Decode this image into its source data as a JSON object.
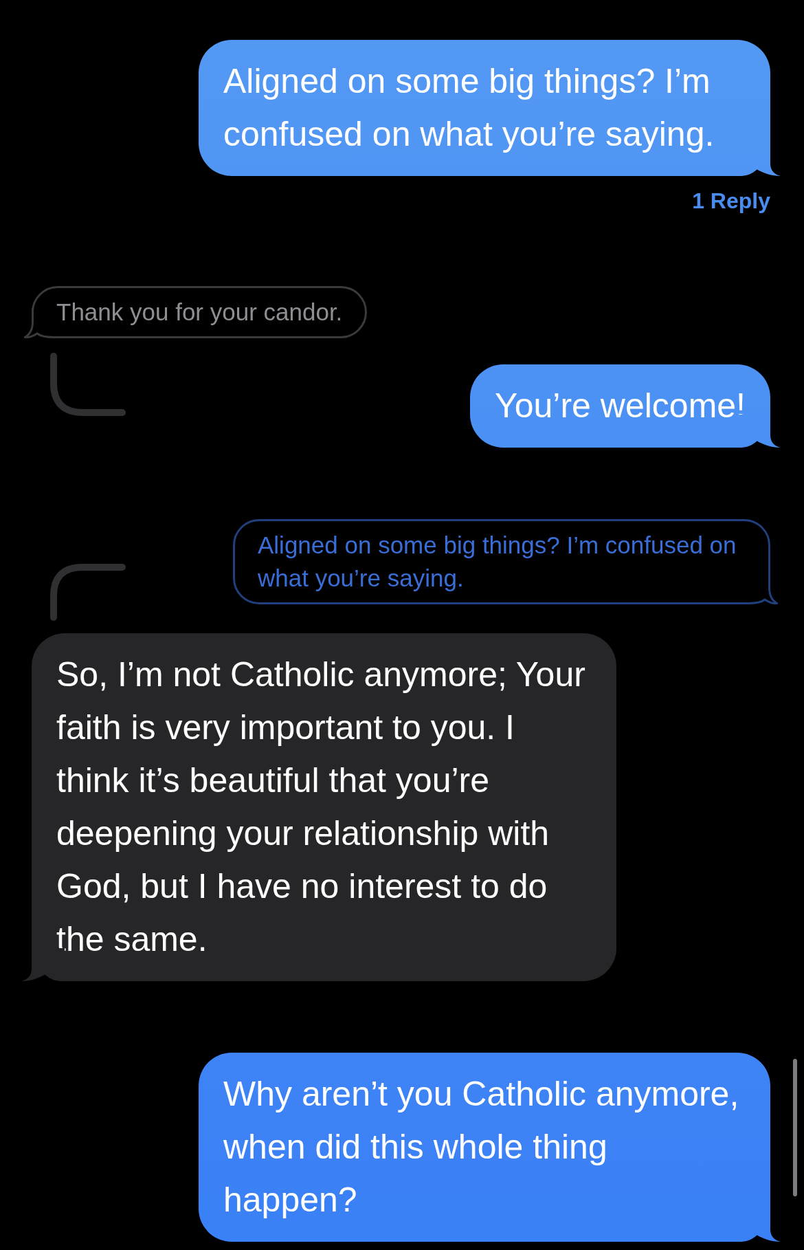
{
  "messages": [
    {
      "kind": "sent",
      "text": "Aligned on some big things? I’m confused on what you’re saying.",
      "replies": "1 Reply"
    },
    {
      "kind": "quote_received",
      "text": "Thank you for your candor."
    },
    {
      "kind": "sent",
      "text": "You’re welcome!",
      "thread_from_above": true
    },
    {
      "kind": "quote_sent",
      "text": "Aligned on some big things? I’m confused on what you’re saying.",
      "thread_from_below": true
    },
    {
      "kind": "received",
      "text": "So, I’m not Catholic anymore; Your faith is very important to you. I think it’s beautiful that you’re deepening your relationship with God, but I have no interest to do the same."
    },
    {
      "kind": "sent",
      "text": "Why aren’t you Catholic anymore, when did this whole thing happen?"
    }
  ]
}
